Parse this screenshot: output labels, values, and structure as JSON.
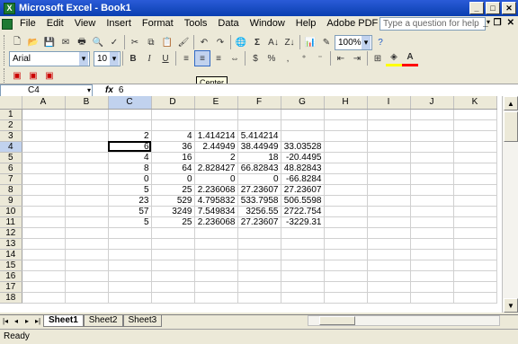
{
  "window": {
    "title": "Microsoft Excel - Book1"
  },
  "menu": [
    "File",
    "Edit",
    "View",
    "Insert",
    "Format",
    "Tools",
    "Data",
    "Window",
    "Help",
    "Adobe PDF"
  ],
  "ask_placeholder": "Type a question for help",
  "toolbar": {
    "zoom": "100%",
    "font": "Arial",
    "font_size": "10",
    "tooltip": "Center"
  },
  "name_box": "C4",
  "formula": "6",
  "columns": [
    "A",
    "B",
    "C",
    "D",
    "E",
    "F",
    "G",
    "H",
    "I",
    "J",
    "K"
  ],
  "rows": [
    {
      "n": "1",
      "c": [
        "",
        "",
        "",
        "",
        "",
        "",
        "",
        "",
        "",
        "",
        ""
      ]
    },
    {
      "n": "2",
      "c": [
        "",
        "",
        "",
        "",
        "",
        "",
        "",
        "",
        "",
        "",
        ""
      ]
    },
    {
      "n": "3",
      "c": [
        "",
        "",
        "2",
        "4",
        "1.414214",
        "5.414214",
        "",
        "",
        "",
        "",
        ""
      ]
    },
    {
      "n": "4",
      "c": [
        "",
        "",
        "6",
        "36",
        "2.44949",
        "38.44949",
        "33.03528",
        "",
        "",
        "",
        ""
      ]
    },
    {
      "n": "5",
      "c": [
        "",
        "",
        "4",
        "16",
        "2",
        "18",
        "-20.4495",
        "",
        "",
        "",
        ""
      ]
    },
    {
      "n": "6",
      "c": [
        "",
        "",
        "8",
        "64",
        "2.828427",
        "66.82843",
        "48.82843",
        "",
        "",
        "",
        ""
      ]
    },
    {
      "n": "7",
      "c": [
        "",
        "",
        "0",
        "0",
        "0",
        "0",
        "-66.8284",
        "",
        "",
        "",
        ""
      ]
    },
    {
      "n": "8",
      "c": [
        "",
        "",
        "5",
        "25",
        "2.236068",
        "27.23607",
        "27.23607",
        "",
        "",
        "",
        ""
      ]
    },
    {
      "n": "9",
      "c": [
        "",
        "",
        "23",
        "529",
        "4.795832",
        "533.7958",
        "506.5598",
        "",
        "",
        "",
        ""
      ]
    },
    {
      "n": "10",
      "c": [
        "",
        "",
        "57",
        "3249",
        "7.549834",
        "3256.55",
        "2722.754",
        "",
        "",
        "",
        ""
      ]
    },
    {
      "n": "11",
      "c": [
        "",
        "",
        "5",
        "25",
        "2.236068",
        "27.23607",
        "-3229.31",
        "",
        "",
        "",
        ""
      ]
    },
    {
      "n": "12",
      "c": [
        "",
        "",
        "",
        "",
        "",
        "",
        "",
        "",
        "",
        "",
        ""
      ]
    },
    {
      "n": "13",
      "c": [
        "",
        "",
        "",
        "",
        "",
        "",
        "",
        "",
        "",
        "",
        ""
      ]
    },
    {
      "n": "14",
      "c": [
        "",
        "",
        "",
        "",
        "",
        "",
        "",
        "",
        "",
        "",
        ""
      ]
    },
    {
      "n": "15",
      "c": [
        "",
        "",
        "",
        "",
        "",
        "",
        "",
        "",
        "",
        "",
        ""
      ]
    },
    {
      "n": "16",
      "c": [
        "",
        "",
        "",
        "",
        "",
        "",
        "",
        "",
        "",
        "",
        ""
      ]
    },
    {
      "n": "17",
      "c": [
        "",
        "",
        "",
        "",
        "",
        "",
        "",
        "",
        "",
        "",
        ""
      ]
    },
    {
      "n": "18",
      "c": [
        "",
        "",
        "",
        "",
        "",
        "",
        "",
        "",
        "",
        "",
        ""
      ]
    }
  ],
  "sheets": [
    "Sheet1",
    "Sheet2",
    "Sheet3"
  ],
  "status": "Ready"
}
